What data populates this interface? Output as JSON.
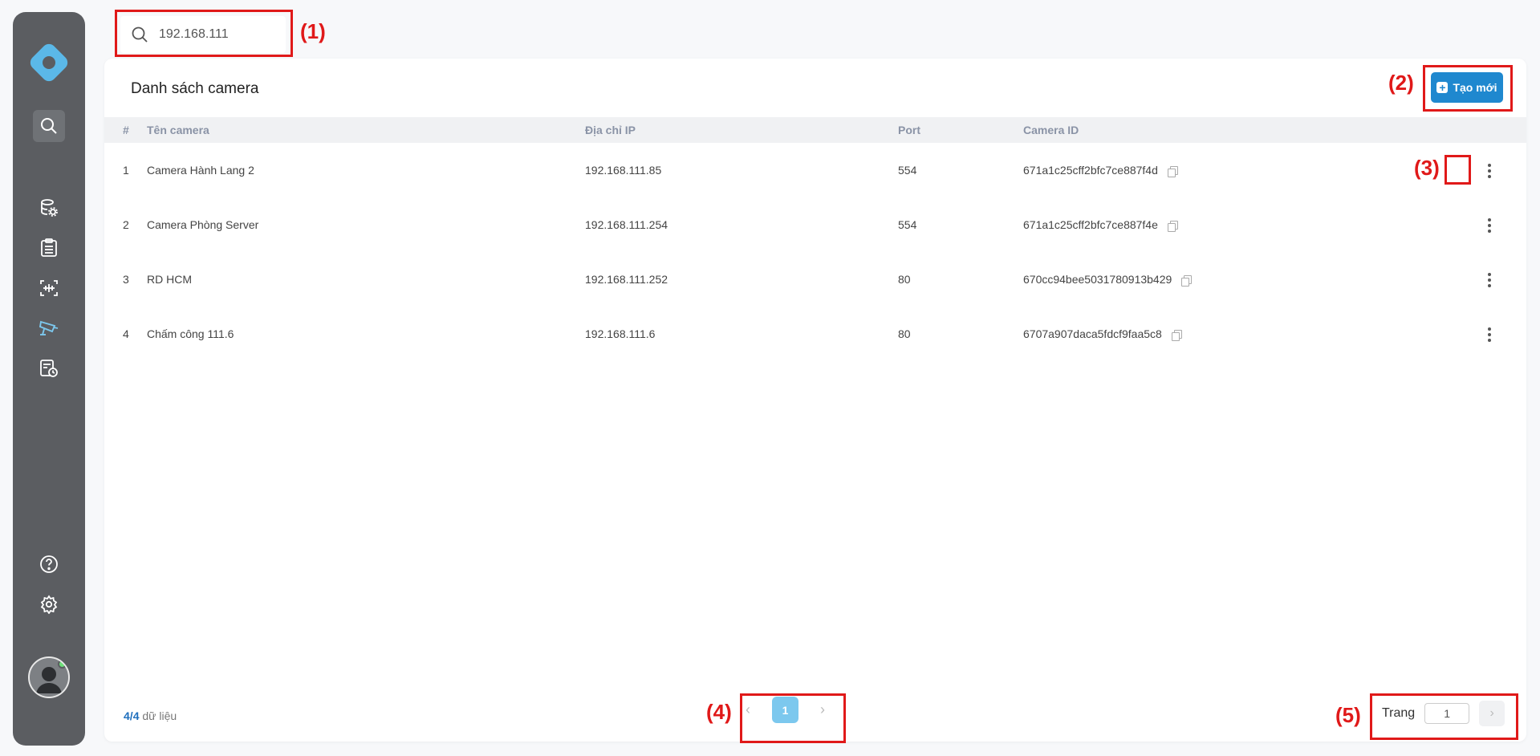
{
  "search": {
    "value": "192.168.111"
  },
  "card": {
    "title": "Danh sách camera",
    "create_label": "Tạo mới"
  },
  "table": {
    "headers": [
      "#",
      "Tên camera",
      "Địa chỉ IP",
      "Port",
      "Camera ID"
    ],
    "rows": [
      {
        "num": "1",
        "name": "Camera Hành Lang 2",
        "ip": "192.168.111.85",
        "port": "554",
        "id": "671a1c25cff2bfc7ce887f4d"
      },
      {
        "num": "2",
        "name": "Camera Phòng Server",
        "ip": "192.168.111.254",
        "port": "554",
        "id": "671a1c25cff2bfc7ce887f4e"
      },
      {
        "num": "3",
        "name": "RD HCM",
        "ip": "192.168.111.252",
        "port": "80",
        "id": "670cc94bee5031780913b429"
      },
      {
        "num": "4",
        "name": "Chấm công 111.6",
        "ip": "192.168.111.6",
        "port": "80",
        "id": "6707a907daca5fdcf9faa5c8"
      }
    ]
  },
  "footer": {
    "count_shown": "4",
    "count_total": "4",
    "count_suffix": "dữ liệu",
    "current_page": "1",
    "goto_label": "Trang",
    "goto_value": "1"
  },
  "annotations": [
    "(1)",
    "(2)",
    "(3)",
    "(4)",
    "(5)"
  ],
  "icons": {
    "sidebar": [
      "logo-icon",
      "search-icon",
      "database-settings-icon",
      "clipboard-list-icon",
      "face-scan-icon",
      "camera-icon",
      "report-clock-icon",
      "help-icon",
      "settings-icon"
    ]
  },
  "colors": {
    "sidebar": "#5b5d61",
    "primary": "#1f88cf",
    "active_icon": "#7cc8ee",
    "annotation": "#e01919",
    "online": "#6ee07a"
  }
}
